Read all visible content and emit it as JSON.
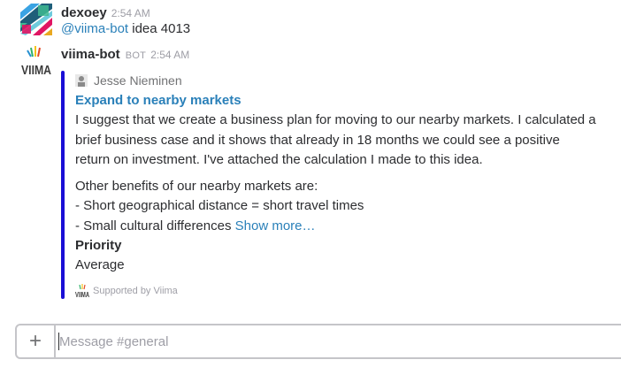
{
  "messages": [
    {
      "user": "dexoey",
      "time": "2:54 AM",
      "mention": "@viima-bot",
      "text": " idea 4013"
    },
    {
      "user": "viima-bot",
      "badge": "BOT",
      "time": "2:54 AM",
      "attachment": {
        "author": "Jesse Nieminen",
        "title": "Expand to nearby markets",
        "paragraph1": "I suggest that we create a business plan for moving to our nearby markets. I calculated a brief business case and it shows that already in 18 months we could see a positive return on investment. I've attached the calculation I made to this idea.",
        "paragraph2_line1": "Other benefits of our nearby markets are:",
        "paragraph2_line2": "- Short geographical distance = short travel times",
        "paragraph2_line3": "- Small cultural differences",
        "show_more": "Show more…",
        "field_title": "Priority",
        "field_value": "Average",
        "footer": "Supported by Viima"
      }
    }
  ],
  "composer": {
    "plus_label": "+",
    "placeholder": "Message #general"
  },
  "colors": {
    "link": "#2a80b9",
    "attachment_bar": "#1a0fd6",
    "muted": "#9e9ea6"
  },
  "icons": {
    "dexoey_avatar": "colorful-slack-logo-avatar",
    "bot_avatar": "viima-logo",
    "author_icon": "person-icon",
    "footer_icon": "viima-logo-small"
  }
}
